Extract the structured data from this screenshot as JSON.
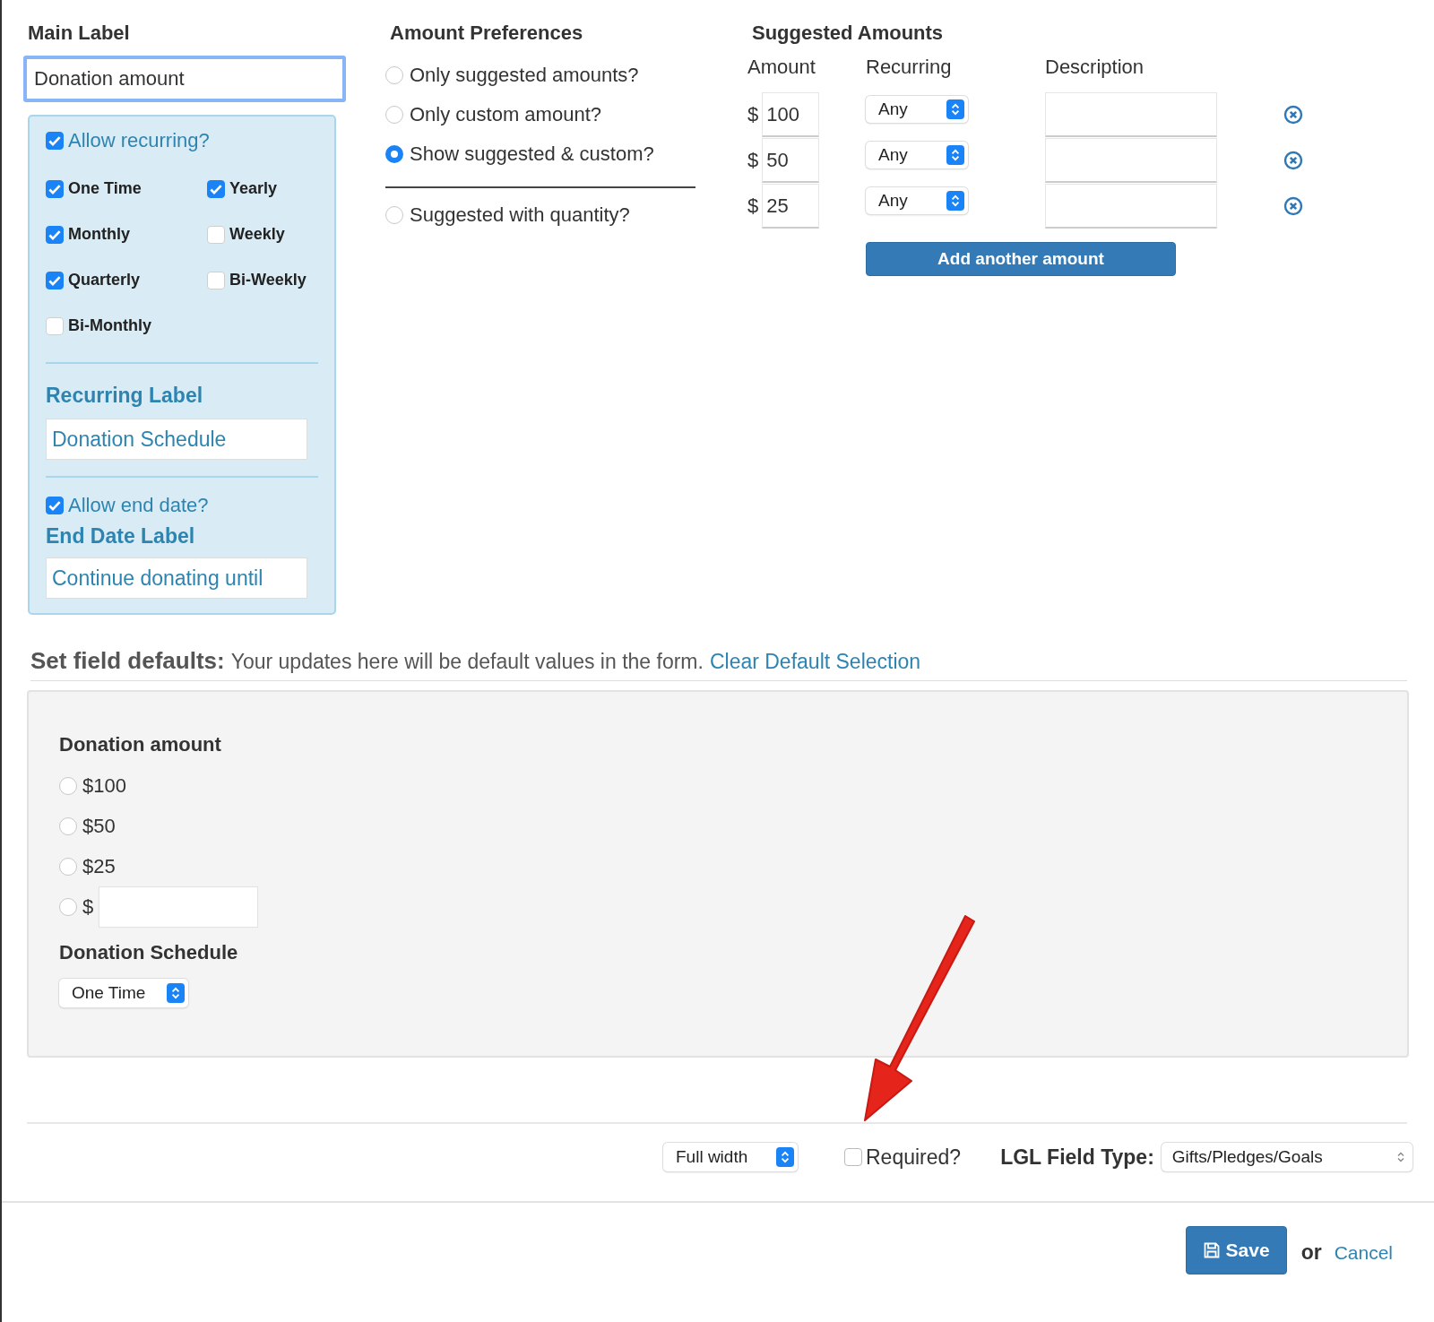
{
  "main_label": {
    "label": "Main Label",
    "value": "Donation amount"
  },
  "recurring_panel": {
    "allow_recurring": {
      "label": "Allow recurring?",
      "checked": true
    },
    "frequencies": [
      {
        "label": "One Time",
        "checked": true
      },
      {
        "label": "Yearly",
        "checked": true
      },
      {
        "label": "Monthly",
        "checked": true
      },
      {
        "label": "Weekly",
        "checked": false
      },
      {
        "label": "Quarterly",
        "checked": true
      },
      {
        "label": "Bi-Weekly",
        "checked": false
      },
      {
        "label": "Bi-Monthly",
        "checked": false
      }
    ],
    "recurring_label": {
      "label": "Recurring Label",
      "value": "Donation Schedule"
    },
    "allow_end_date": {
      "label": "Allow end date?",
      "checked": true
    },
    "end_date_label": {
      "label": "End Date Label",
      "value": "Continue donating until"
    }
  },
  "amount_preferences": {
    "title": "Amount Preferences",
    "options": [
      {
        "label": "Only suggested amounts?",
        "selected": false,
        "separated_before": false
      },
      {
        "label": "Only custom amount?",
        "selected": false,
        "separated_before": false
      },
      {
        "label": "Show suggested & custom?",
        "selected": true,
        "separated_before": false
      },
      {
        "label": "Suggested with quantity?",
        "selected": false,
        "separated_before": true
      }
    ]
  },
  "suggested_amounts": {
    "title": "Suggested Amounts",
    "columns": [
      "Amount",
      "Recurring",
      "Description"
    ],
    "rows": [
      {
        "currency": "$",
        "amount": "100",
        "recurring": "Any"
      },
      {
        "currency": "$",
        "amount": "50",
        "recurring": "Any"
      },
      {
        "currency": "$",
        "amount": "25",
        "recurring": "Any"
      }
    ],
    "add_button": "Add another amount"
  },
  "defaults": {
    "title": "Set field defaults:",
    "hint": "Your updates here will be default values in the form.",
    "link": "Clear Default Selection",
    "form": {
      "amount_label": "Donation amount",
      "options": [
        {
          "label": "$100",
          "selected": false
        },
        {
          "label": "$50",
          "selected": false
        },
        {
          "label": "$25",
          "selected": false
        }
      ],
      "custom": {
        "currency": "$",
        "selected": false
      },
      "schedule_label": "Donation Schedule",
      "schedule_value": "One Time"
    }
  },
  "field_settings": {
    "width": "Full width",
    "required": {
      "label": "Required?",
      "checked": false
    },
    "field_type": {
      "label": "LGL Field Type:",
      "value": "Gifts/Pledges/Goals"
    }
  },
  "actions": {
    "save": "Save",
    "or": "or",
    "cancel": "Cancel"
  }
}
